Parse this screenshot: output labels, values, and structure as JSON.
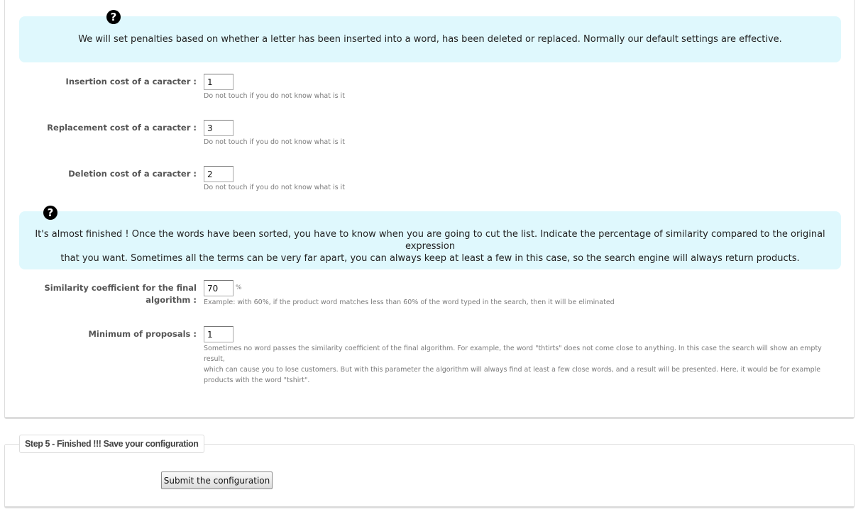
{
  "help_icon": "question-circle-icon",
  "colors": {
    "help_box_bg": "#dff8fd",
    "label_text": "#555555",
    "hint_text": "#7a7a7a"
  },
  "penalties_help": {
    "text": "We will set penalties based on whether a letter has been inserted into a word, has been deleted or replaced. Normally our default settings are effective."
  },
  "insertion": {
    "label": "Insertion cost of a caracter :",
    "value": "1",
    "hint": "Do not touch if you do not know what is it"
  },
  "replacement": {
    "label": "Replacement cost of a caracter :",
    "value": "3",
    "hint": "Do not touch if you do not know what is it"
  },
  "deletion": {
    "label": "Deletion cost of a caracter :",
    "value": "2",
    "hint": "Do not touch if you do not know what is it"
  },
  "similarity_help": {
    "line1": "It's almost finished ! Once the words have been sorted, you have to know when you are going to cut the list. Indicate the percentage of similarity compared to the original expression",
    "line2": "that you want. Sometimes all the terms can be very far apart, you can always keep at least a few in this case, so the search engine will always return products."
  },
  "similarity": {
    "label_line1": "Similarity coefficient for the final",
    "label_line2": "algorithm :",
    "value": "70",
    "unit": "%",
    "hint": "Example: with 60%, if the product word matches less than 60% of the word typed in the search, then it will be eliminated"
  },
  "min_proposals": {
    "label": "Minimum of proposals :",
    "value": "1",
    "hint_line1": "Sometimes no word passes the similarity coefficient of the final algorithm. For example, the word \"thtirts\" does not come close to anything. In this case the search will show an empty result,",
    "hint_line2": "which can cause you to lose customers. But with this parameter the algorithm will always find at least a few close words, and a result will be presented. Here, it would be for example",
    "hint_line3": "products with the word \"tshirt\"."
  },
  "step5": {
    "legend": "Step 5 - Finished !!! Save your configuration",
    "submit_label": "Submit the configuration"
  }
}
